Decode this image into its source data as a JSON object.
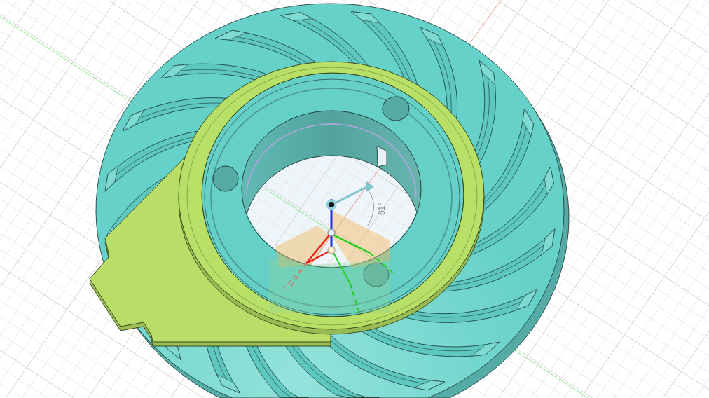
{
  "viewport": {
    "rotation_gizmo": {
      "angle_readout": "61°"
    }
  }
}
